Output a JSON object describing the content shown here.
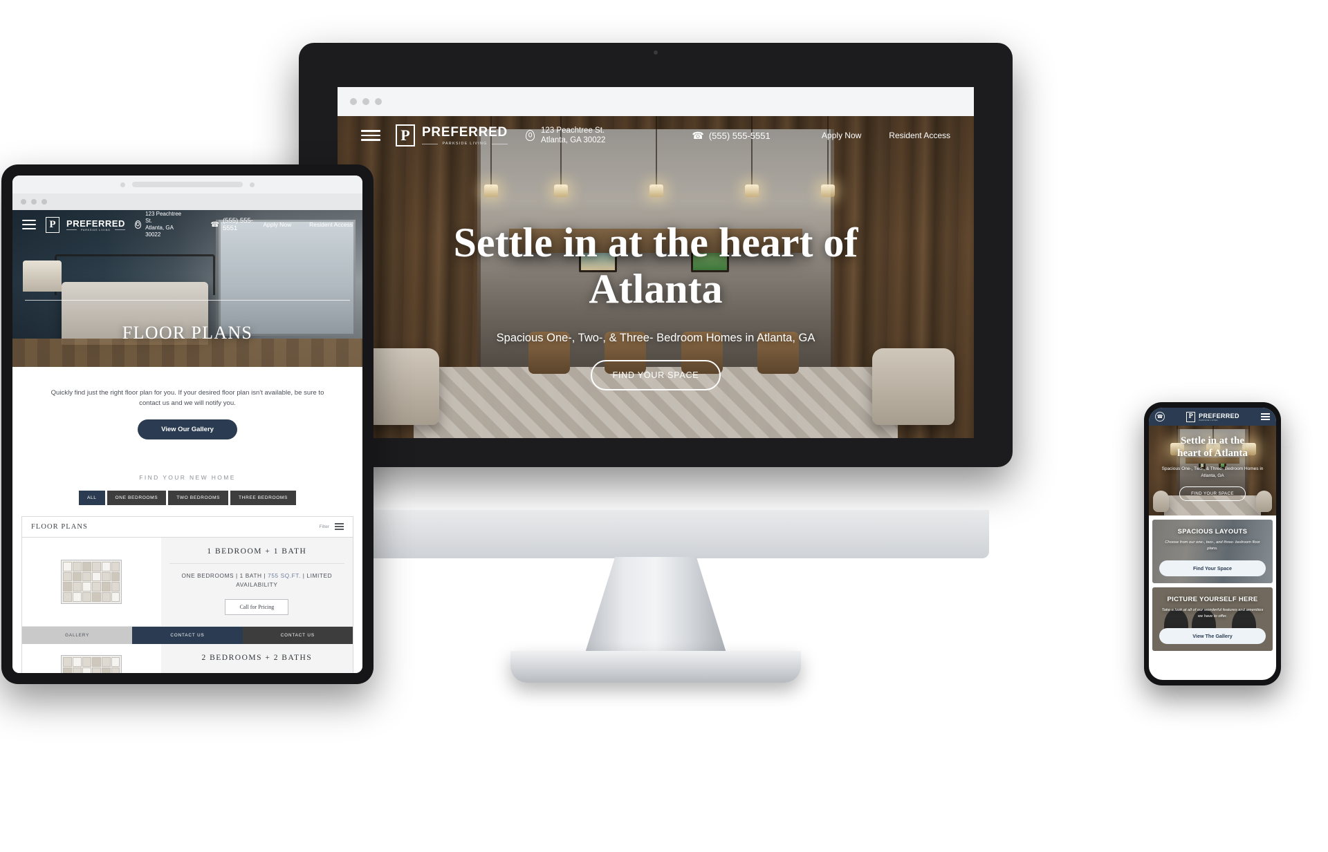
{
  "brand": {
    "name": "PREFERRED",
    "tagline": "PARKSIDE LIVING",
    "mark_letter": "P",
    "accent_navy": "#2b3c52",
    "accent_dark": "#3d3d3d"
  },
  "nav": {
    "menu_icon": "hamburger-menu-icon",
    "location_icon": "map-pin-icon",
    "address_line1": "123 Peachtree St.",
    "address_line2": "Atlanta, GA 30022",
    "phone_icon": "phone-icon",
    "phone": "(555) 555-5551",
    "links": [
      {
        "label": "Apply Now"
      },
      {
        "label": "Resident Access"
      }
    ]
  },
  "desktop": {
    "browser_dots": 3,
    "hero": {
      "headline_line1": "Settle in at the heart of",
      "headline_line2": "Atlanta",
      "subheadline": "Spacious One-, Two-, & Three- Bedroom Homes in Atlanta, GA",
      "cta_label": "FIND YOUR SPACE"
    }
  },
  "tablet": {
    "hero_title": "FLOOR PLANS",
    "intro_paragraph": "Quickly find just the right floor plan for you. If your desired floor plan isn't available, be sure to contact us and we will notify you.",
    "intro_cta": "View Our Gallery",
    "eyebrow": "FIND YOUR NEW HOME",
    "filters": [
      {
        "label": "ALL",
        "active": true
      },
      {
        "label": "ONE BEDROOMS",
        "active": false
      },
      {
        "label": "TWO BEDROOMS",
        "active": false
      },
      {
        "label": "THREE BEDROOMS",
        "active": false
      }
    ],
    "panel": {
      "heading": "FLOOR PLANS",
      "filter_label": "Filter",
      "filter_icon": "filter-list-icon"
    },
    "plans": [
      {
        "title": "1 BEDROOM + 1 BATH",
        "meta_prefix": "ONE BEDROOMS | 1 BATH | ",
        "meta_sqft": "755 SQ.FT.",
        "meta_suffix": " | LIMITED AVAILABILITY",
        "price_button": "Call for Pricing",
        "actions": [
          {
            "label": "GALLERY",
            "style": "light"
          },
          {
            "label": "CONTACT US",
            "style": "navy"
          },
          {
            "label": "CONTACT US",
            "style": "dark"
          }
        ]
      },
      {
        "title": "2 BEDROOMS + 2 BATHS"
      }
    ]
  },
  "phone": {
    "call_icon": "phone-circle-icon",
    "menu_icon": "hamburger-menu-icon",
    "hero": {
      "headline_line1": "Settle in at the",
      "headline_line2": "heart of Atlanta",
      "subheadline": "Spacious One-, Two-, & Three- Bedroom Homes in Atlanta, GA",
      "cta_label": "FIND YOUR SPACE"
    },
    "sections": [
      {
        "title": "SPACIOUS LAYOUTS",
        "body": "Choose from our one-, two-, and three- bedroom floor plans.",
        "cta_label": "Find Your Space"
      },
      {
        "title": "PICTURE YOURSELF HERE",
        "body": "Take a look at all of our wonderful features and amenities we have to offer.",
        "cta_label": "View The Gallery"
      }
    ]
  }
}
